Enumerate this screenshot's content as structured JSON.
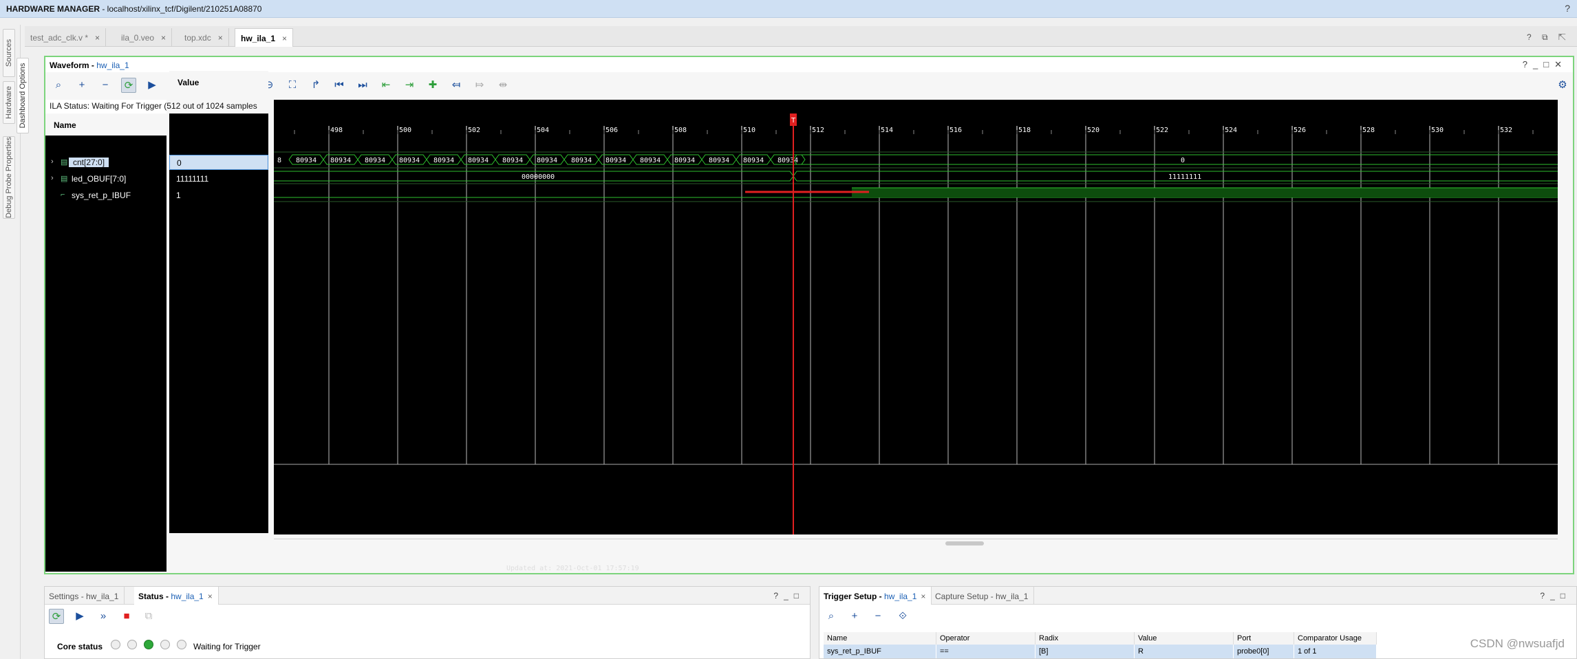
{
  "app": {
    "title_bold": "HARDWARE MANAGER",
    "title_rest": " - localhost/xilinx_tcf/Digilent/210251A08870"
  },
  "left_tabs": [
    "Sources",
    "Hardware",
    "Dashboard Options",
    "Debug Probe Properties"
  ],
  "file_tabs": [
    {
      "label": "test_adc_clk.v *",
      "active": false
    },
    {
      "label": "ila_0.veo",
      "active": false
    },
    {
      "label": "top.xdc",
      "active": false
    },
    {
      "label": "hw_ila_1",
      "active": true
    }
  ],
  "waveform": {
    "title": "Waveform",
    "title_link": "hw_ila_1",
    "ila_status": "ILA Status:  Waiting For Trigger (512 out of 1024 samples",
    "name_header": "Name",
    "value_header": "Value",
    "signals": [
      {
        "name": "cnt[27:0]",
        "value": "0",
        "icon": "bus-icon",
        "expandable": true,
        "selected": true
      },
      {
        "name": "led_OBUF[7:0]",
        "value": "11111111",
        "icon": "bus-icon",
        "expandable": true,
        "selected": false
      },
      {
        "name": "sys_ret_p_IBUF",
        "value": "1",
        "icon": "bit-icon",
        "expandable": false,
        "selected": false
      }
    ],
    "updated": "Updated at: 2021-Oct-01 17:57:19",
    "ticks": [
      "498",
      "500",
      "502",
      "504",
      "506",
      "508",
      "510",
      "512",
      "514",
      "516",
      "518",
      "520",
      "522",
      "524",
      "526",
      "528",
      "530",
      "532"
    ],
    "trigger_marker": "T",
    "cnt_left_fragment": "8",
    "cnt_repeat_value": "80934",
    "led_before": "00000000",
    "led_after": "11111111",
    "cnt_after": "0"
  },
  "settings_panel": {
    "tabs": [
      {
        "label": "Settings - hw_ila_1",
        "active": false
      },
      {
        "label": "Status",
        "link": "hw_ila_1",
        "active": true
      }
    ],
    "core_status_label": "Core status",
    "status_text": "Waiting for Trigger"
  },
  "trigger_panel": {
    "tabs": [
      {
        "label": "Trigger Setup",
        "link": "hw_ila_1",
        "active": true
      },
      {
        "label": "Capture Setup - hw_ila_1",
        "active": false
      }
    ],
    "columns": [
      "Name",
      "Operator",
      "Radix",
      "Value",
      "Port",
      "Comparator Usage"
    ],
    "row": [
      "sys_ret_p_IBUF",
      "==",
      "[B]",
      "R",
      "probe0[0]",
      "1 of 1"
    ]
  },
  "watermark": "CSDN @nwsuafjd",
  "colors": {
    "accent": "#7cd47c",
    "selection": "#cfe0f3",
    "trigger": "#e02020",
    "wave": "#2ec12e"
  }
}
